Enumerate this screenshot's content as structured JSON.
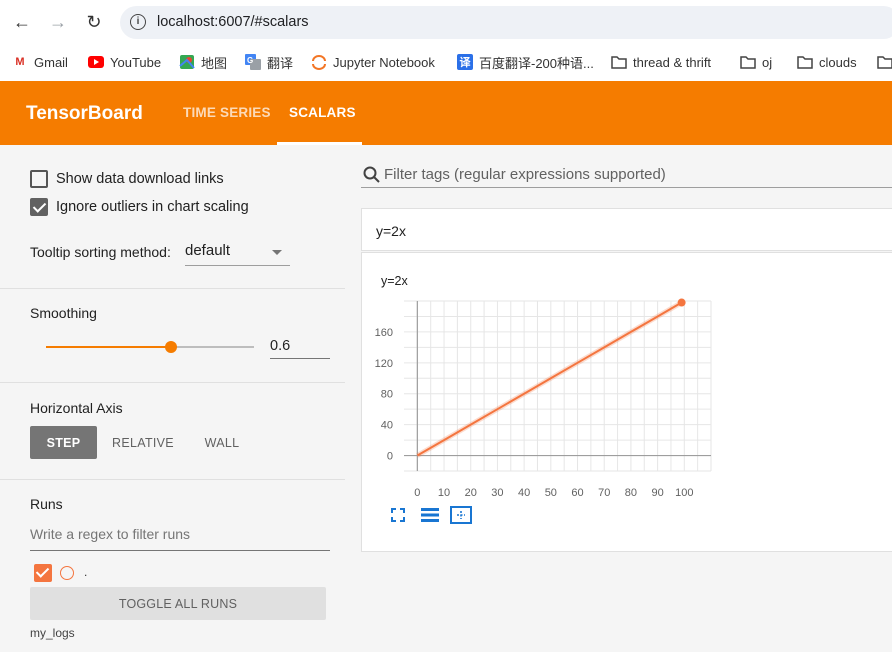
{
  "browser": {
    "url": "localhost:6007/#scalars",
    "bookmarks": [
      "Gmail",
      "YouTube",
      "地图",
      "翻译",
      "Jupyter Notebook",
      "百度翻译-200种语...",
      "thread & thrift",
      "oj",
      "clouds"
    ]
  },
  "header": {
    "logo": "TensorBoard",
    "tabs": [
      "TIME SERIES",
      "SCALARS"
    ],
    "active_tab": "SCALARS",
    "accent_color": "#f57c00"
  },
  "sidebar": {
    "show_download_links": {
      "label": "Show data download links",
      "checked": false
    },
    "ignore_outliers": {
      "label": "Ignore outliers in chart scaling",
      "checked": true
    },
    "tooltip_label": "Tooltip sorting method:",
    "tooltip_value": "default",
    "smoothing_label": "Smoothing",
    "smoothing_value": "0.6",
    "horizontal_axis_label": "Horizontal Axis",
    "axis_buttons": [
      "STEP",
      "RELATIVE",
      "WALL"
    ],
    "axis_selected": "STEP",
    "runs_label": "Runs",
    "runs_placeholder": "Write a regex to filter runs",
    "run_name": ".",
    "run_color": "#f4753f",
    "toggle_label": "TOGGLE ALL RUNS",
    "logdir": "my_logs"
  },
  "main": {
    "filter_placeholder": "Filter tags (regular expressions supported)",
    "card_title": "y=2x"
  },
  "chart_data": {
    "type": "line",
    "title": "y=2x",
    "x": [
      0,
      10,
      20,
      30,
      40,
      50,
      60,
      70,
      80,
      90,
      99
    ],
    "series": [
      {
        "values": [
          0,
          20,
          40,
          60,
          80,
          100,
          120,
          140,
          160,
          180,
          198
        ],
        "color": "#f4753f"
      }
    ],
    "x_ticks": [
      0,
      10,
      20,
      30,
      40,
      50,
      60,
      70,
      80,
      90,
      100
    ],
    "y_ticks": [
      0,
      40,
      80,
      120,
      160
    ],
    "xlim": [
      -5,
      110
    ],
    "ylim": [
      -20,
      200
    ],
    "grid": true
  }
}
